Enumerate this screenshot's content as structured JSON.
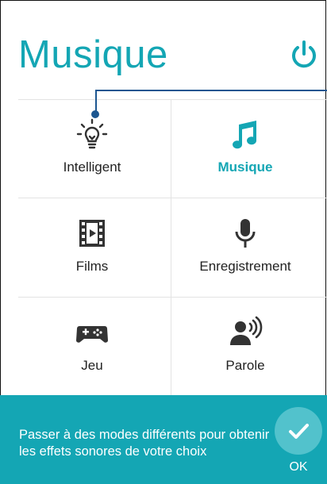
{
  "header": {
    "title": "Musique",
    "power_icon": "power-icon"
  },
  "colors": {
    "accent": "#14a6b4",
    "callout": "#1c5690",
    "icon": "#333333"
  },
  "modes": [
    {
      "label": "Intelligent",
      "icon": "lightbulb-icon",
      "active": false
    },
    {
      "label": "Musique",
      "icon": "music-note-icon",
      "active": true
    },
    {
      "label": "Films",
      "icon": "film-icon",
      "active": false
    },
    {
      "label": "Enregistrement",
      "icon": "microphone-icon",
      "active": false
    },
    {
      "label": "Jeu",
      "icon": "gamepad-icon",
      "active": false
    },
    {
      "label": "Parole",
      "icon": "speaker-voice-icon",
      "active": false
    }
  ],
  "banner": {
    "message": "Passer à des modes différents pour obtenir les effets sonores de votre choix",
    "ok_label": "OK"
  }
}
